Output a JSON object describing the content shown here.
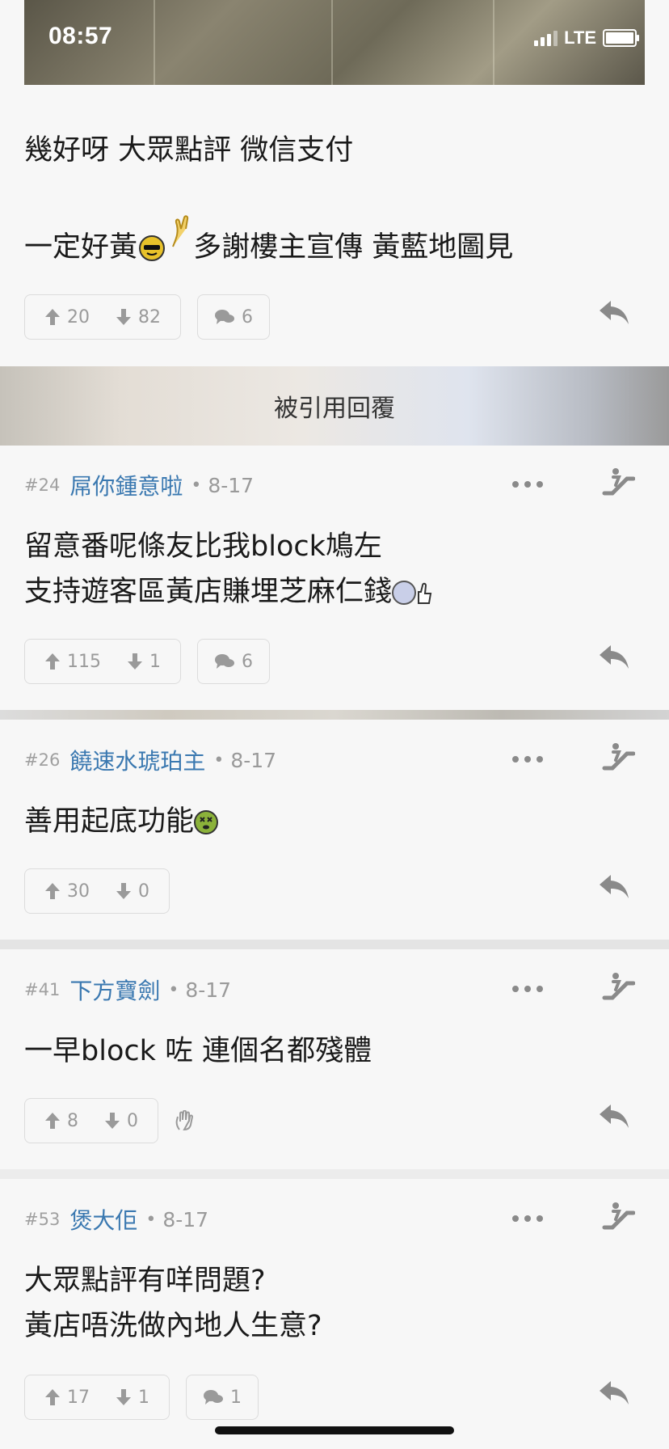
{
  "status_bar": {
    "time": "08:57",
    "network": "LTE"
  },
  "top_post": {
    "line1": "幾好呀 大眾點評 微信支付",
    "line2": "一定好黃",
    "line2_rest": " 多謝樓主宣傳 黃藍地圖見",
    "upvotes": "20",
    "downvotes": "82",
    "comments": "6"
  },
  "quoted_banner": {
    "label": "被引用回覆"
  },
  "replies": [
    {
      "num": "#24",
      "user": "屌你鍾意啦",
      "date": "8-17",
      "lines": [
        "留意番呢條友比我block鳩左",
        "支持遊客區黃店賺埋芝麻仁錢"
      ],
      "upvotes": "115",
      "downvotes": "1",
      "comments": "6"
    },
    {
      "num": "#26",
      "user": "饒速水琥珀主",
      "date": "8-17",
      "lines": [
        "善用起底功能"
      ],
      "upvotes": "30",
      "downvotes": "0"
    },
    {
      "num": "#41",
      "user": "下方寶劍",
      "date": "8-17",
      "lines": [
        "一早block 咗 連個名都殘體"
      ],
      "upvotes": "8",
      "downvotes": "0"
    },
    {
      "num": "#53",
      "user": "煲大佢",
      "date": "8-17",
      "lines": [
        "大眾點評有咩問題?",
        "黃店唔洗做內地人生意?"
      ],
      "upvotes": "17",
      "downvotes": "1",
      "comments": "1"
    }
  ],
  "icons": {
    "upvote": "arrow-up-icon",
    "downvote": "arrow-down-icon",
    "comment": "speech-bubbles-icon",
    "reply": "reply-arrow-icon",
    "more": "more-dots-icon",
    "escalator": "escalator-icon",
    "hand": "raised-hand-icon"
  },
  "colors": {
    "username": "#3a78b0",
    "meta_grey": "#9a9a9a",
    "background": "#f7f7f7"
  }
}
